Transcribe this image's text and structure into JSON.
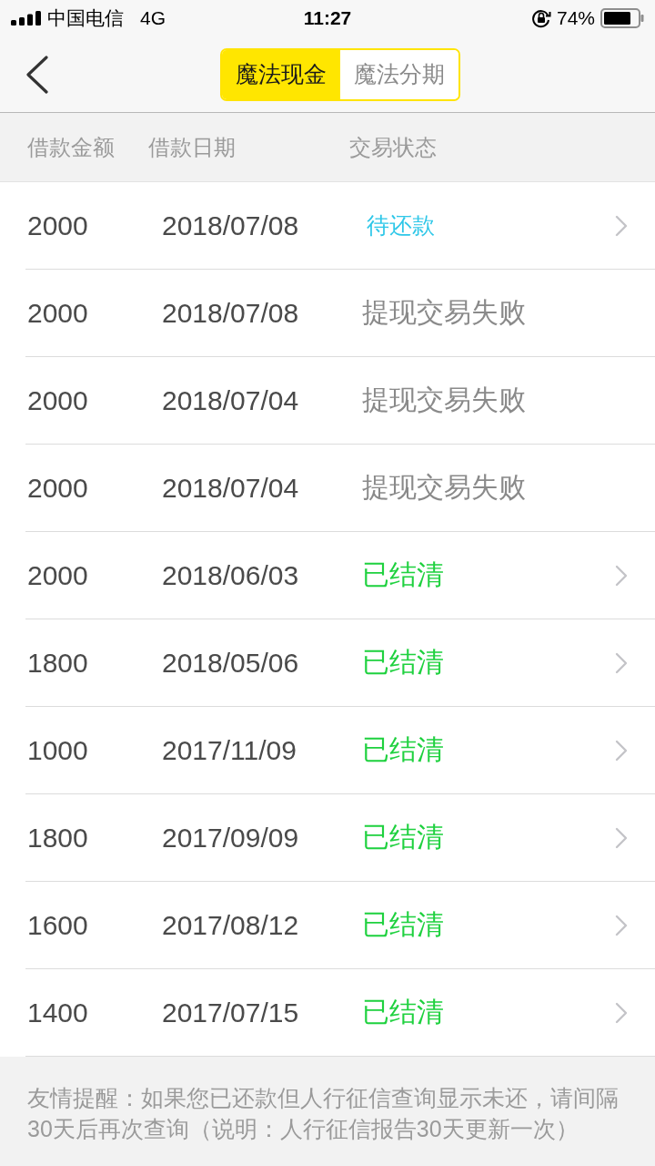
{
  "status_bar": {
    "carrier": "中国电信",
    "network": "4G",
    "time": "11:27",
    "battery_percent": "74%"
  },
  "nav": {
    "tabs": [
      {
        "label": "魔法现金",
        "selected": true
      },
      {
        "label": "魔法分期",
        "selected": false
      }
    ]
  },
  "table": {
    "columns": [
      "借款金额",
      "借款日期",
      "交易状态"
    ],
    "rows": [
      {
        "amount": "2000",
        "date": "2018/07/08",
        "status": "待还款",
        "kind": "pending",
        "has_chevron": true
      },
      {
        "amount": "2000",
        "date": "2018/07/08",
        "status": "提现交易失败",
        "kind": "failed",
        "has_chevron": false
      },
      {
        "amount": "2000",
        "date": "2018/07/04",
        "status": "提现交易失败",
        "kind": "failed",
        "has_chevron": false
      },
      {
        "amount": "2000",
        "date": "2018/07/04",
        "status": "提现交易失败",
        "kind": "failed",
        "has_chevron": false
      },
      {
        "amount": "2000",
        "date": "2018/06/03",
        "status": "已结清",
        "kind": "settled",
        "has_chevron": true
      },
      {
        "amount": "1800",
        "date": "2018/05/06",
        "status": "已结清",
        "kind": "settled",
        "has_chevron": true
      },
      {
        "amount": "1000",
        "date": "2017/11/09",
        "status": "已结清",
        "kind": "settled",
        "has_chevron": true
      },
      {
        "amount": "1800",
        "date": "2017/09/09",
        "status": "已结清",
        "kind": "settled",
        "has_chevron": true
      },
      {
        "amount": "1600",
        "date": "2017/08/12",
        "status": "已结清",
        "kind": "settled",
        "has_chevron": true
      },
      {
        "amount": "1400",
        "date": "2017/07/15",
        "status": "已结清",
        "kind": "settled",
        "has_chevron": true
      }
    ]
  },
  "notice": "友情提醒：如果您已还款但人行征信查询显示未还，请间隔30天后再次查询（说明：人行征信报告30天更新一次）"
}
